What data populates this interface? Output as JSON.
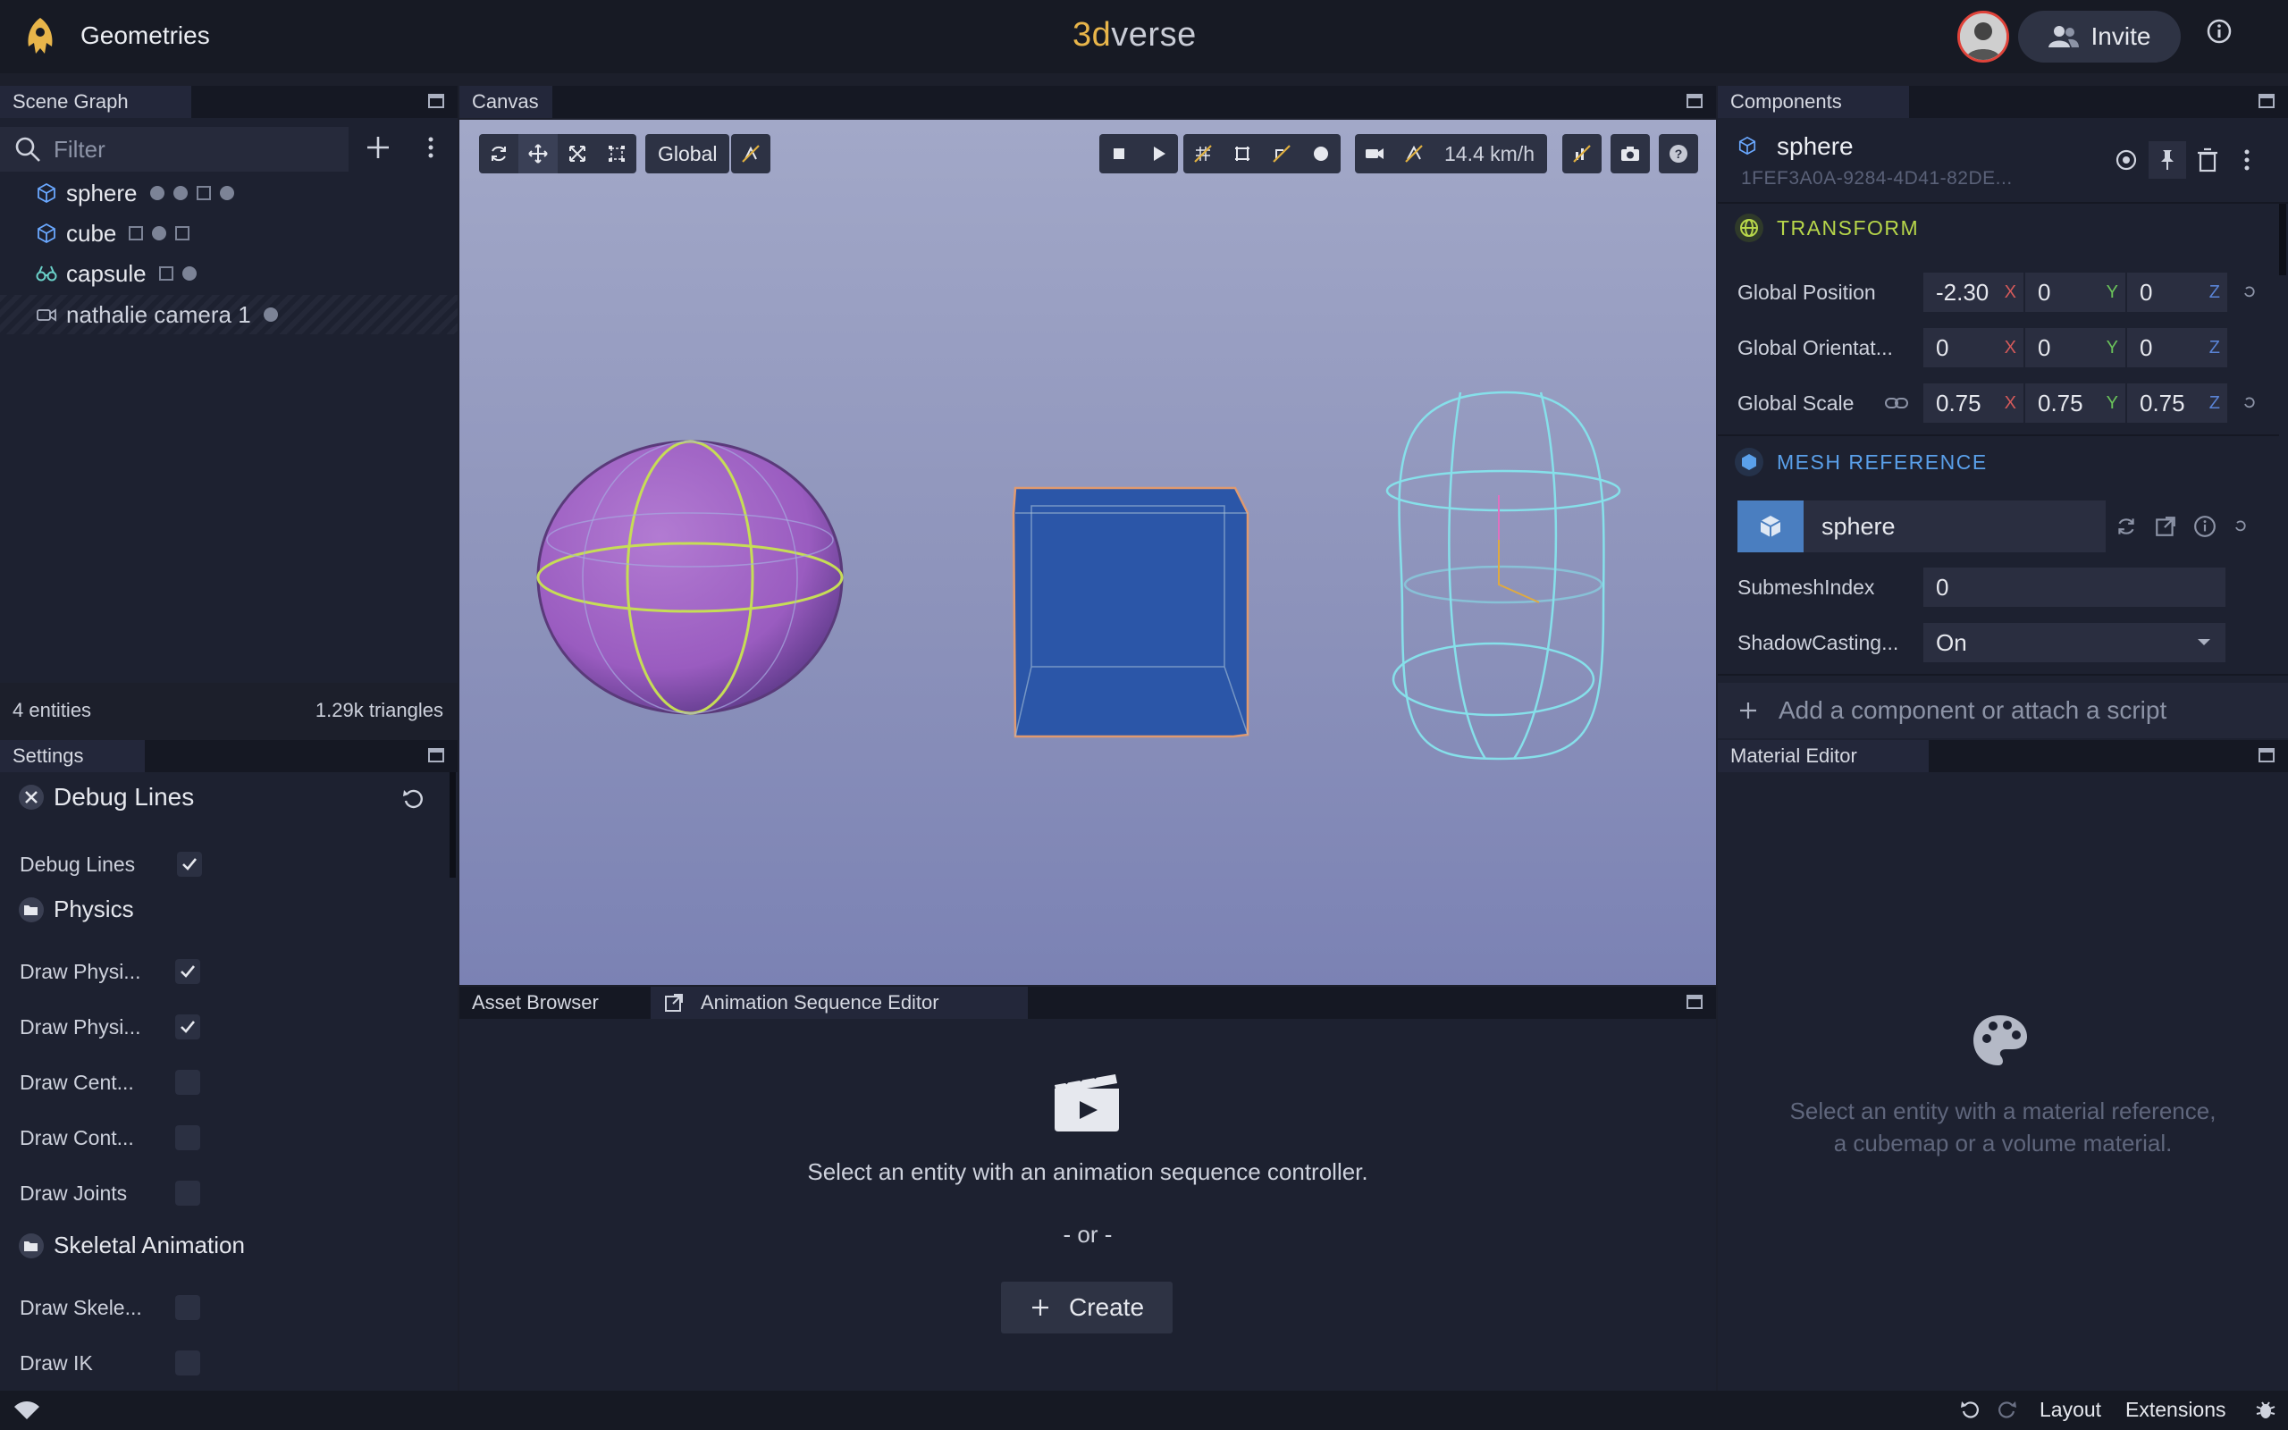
{
  "app": {
    "project_title": "Geometries",
    "brand_prefix": "3d",
    "brand_suffix": "verse",
    "invite_label": "Invite"
  },
  "scene_graph": {
    "tab_label": "Scene Graph",
    "filter_placeholder": "Filter",
    "entities": [
      {
        "name": "sphere",
        "icon": "cube-icon"
      },
      {
        "name": "cube",
        "icon": "cube-icon"
      },
      {
        "name": "capsule",
        "icon": "binoculars-icon"
      },
      {
        "name": "nathalie camera 1",
        "icon": "camera-icon"
      }
    ],
    "entity_count": "4 entities",
    "triangle_count": "1.29k triangles"
  },
  "settings": {
    "tab_label": "Settings",
    "debug_lines_section": "Debug Lines",
    "debug_lines_label": "Debug Lines",
    "debug_lines_checked": true,
    "physics_section": "Physics",
    "physics_items": [
      {
        "label": "Draw Physi...",
        "checked": true
      },
      {
        "label": "Draw Physi...",
        "checked": true
      },
      {
        "label": "Draw Cent...",
        "checked": false
      },
      {
        "label": "Draw Cont...",
        "checked": false
      },
      {
        "label": "Draw Joints",
        "checked": false
      }
    ],
    "skeletal_section": "Skeletal Animation",
    "skeletal_items": [
      {
        "label": "Draw Skele...",
        "checked": false
      },
      {
        "label": "Draw IK",
        "checked": false
      }
    ]
  },
  "canvas": {
    "tab_label": "Canvas",
    "space_label": "Global",
    "speed_label": "14.4 km/h"
  },
  "bottom_panel": {
    "tab_asset_browser": "Asset Browser",
    "tab_animation": "Animation Sequence Editor",
    "message": "Select an entity with an animation sequence controller.",
    "or_label": "- or -",
    "create_label": "Create"
  },
  "components": {
    "tab_label": "Components",
    "entity_name": "sphere",
    "entity_uuid": "1FEF3A0A-9284-4D41-82DE...",
    "transform_title": "TRANSFORM",
    "global_position_label": "Global Position",
    "global_position": [
      "-2.30",
      "0",
      "0"
    ],
    "global_orientation_label": "Global Orientat...",
    "global_orientation": [
      "0",
      "0",
      "0"
    ],
    "global_scale_label": "Global Scale",
    "global_scale": [
      "0.75",
      "0.75",
      "0.75"
    ],
    "axes": [
      "X",
      "Y",
      "Z"
    ],
    "mesh_title": "MESH REFERENCE",
    "mesh_name": "sphere",
    "submesh_label": "SubmeshIndex",
    "submesh_value": "0",
    "shadow_label": "ShadowCasting...",
    "shadow_value": "On",
    "add_component_label": "Add a component or attach a script"
  },
  "material_editor": {
    "tab_label": "Material Editor",
    "message_line1": "Select an entity with a material reference,",
    "message_line2": "a cubemap or a volume material."
  },
  "statusbar": {
    "layout_label": "Layout",
    "extensions_label": "Extensions"
  },
  "colors": {
    "accent_gold": "#e8b54a",
    "transform_green": "#b7d64a",
    "mesh_blue": "#5aa0ea"
  }
}
